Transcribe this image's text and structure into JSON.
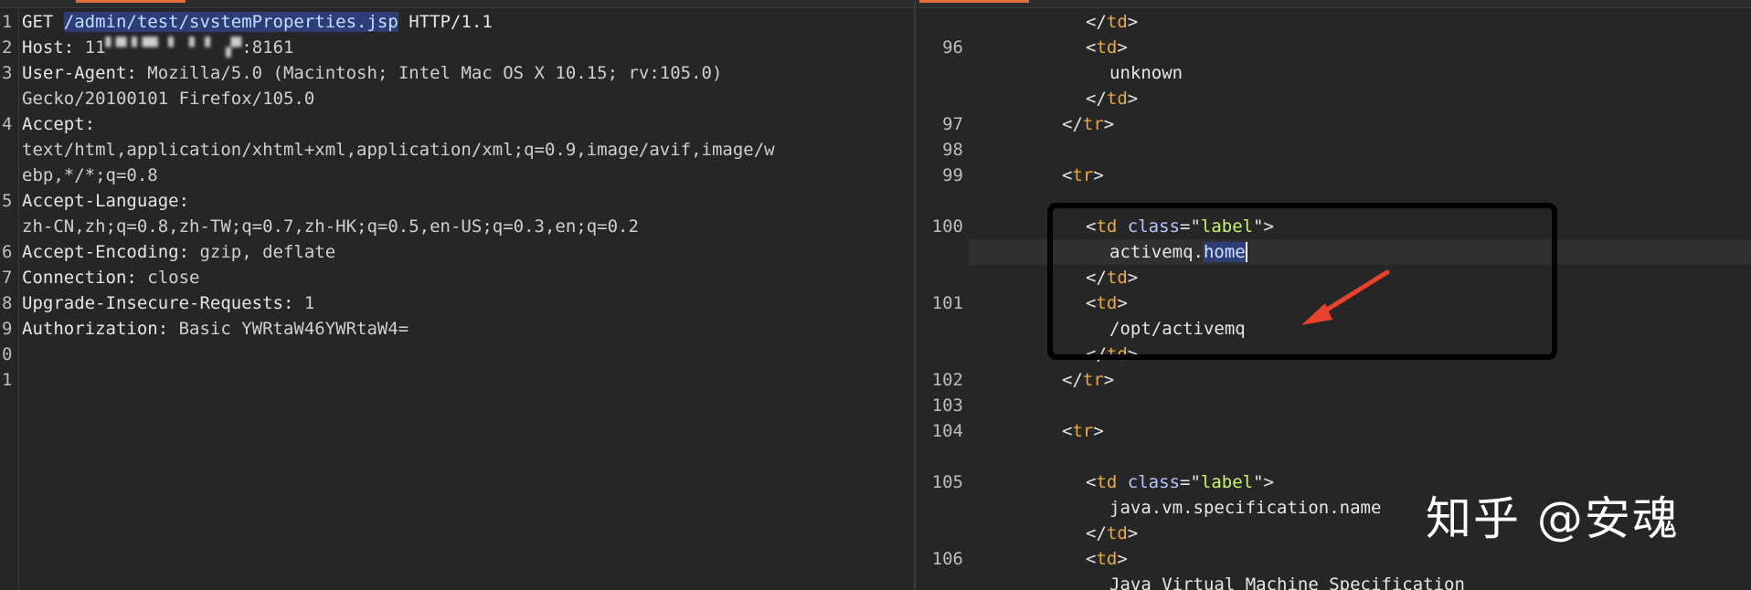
{
  "request": {
    "lines": [
      {
        "n": "1",
        "segs": [
          {
            "t": "GET ",
            "c": "hk"
          },
          {
            "t": "/admin/test/svstemProperties.jsp",
            "c": "path"
          },
          {
            "t": " HTTP/1.1",
            "c": "hk"
          }
        ]
      },
      {
        "n": "2",
        "segs": [
          {
            "t": "Host: ",
            "c": "hk"
          },
          {
            "t": "11",
            "c": "hv"
          },
          {
            "t": "▘▀▝▝▀ ▘ ▘▝ ▗▀",
            "c": "blur"
          },
          {
            "t": ":8161",
            "c": "hv"
          }
        ]
      },
      {
        "n": "3",
        "segs": [
          {
            "t": "User-Agent: ",
            "c": "hk"
          },
          {
            "t": "Mozilla/5.0 (Macintosh; Intel Mac OS X 10.15; rv:105.0)",
            "c": "hv"
          }
        ]
      },
      {
        "n": "",
        "segs": [
          {
            "t": "Gecko/20100101 Firefox/105.0",
            "c": "hv"
          }
        ]
      },
      {
        "n": "4",
        "segs": [
          {
            "t": "Accept:",
            "c": "hk"
          }
        ]
      },
      {
        "n": "",
        "segs": [
          {
            "t": "text/html,application/xhtml+xml,application/xml;q=0.9,image/avif,image/w",
            "c": "hv"
          }
        ]
      },
      {
        "n": "",
        "segs": [
          {
            "t": "ebp,*/*;q=0.8",
            "c": "hv"
          }
        ]
      },
      {
        "n": "5",
        "segs": [
          {
            "t": "Accept-Language:",
            "c": "hk"
          }
        ]
      },
      {
        "n": "",
        "segs": [
          {
            "t": "zh-CN,zh;q=0.8,zh-TW;q=0.7,zh-HK;q=0.5,en-US;q=0.3,en;q=0.2",
            "c": "hv"
          }
        ]
      },
      {
        "n": "6",
        "segs": [
          {
            "t": "Accept-Encoding: ",
            "c": "hk"
          },
          {
            "t": "gzip, deflate",
            "c": "hv"
          }
        ]
      },
      {
        "n": "7",
        "segs": [
          {
            "t": "Connection: ",
            "c": "hk"
          },
          {
            "t": "close",
            "c": "hv"
          }
        ]
      },
      {
        "n": "8",
        "segs": [
          {
            "t": "Upgrade-Insecure-Requests: ",
            "c": "hk"
          },
          {
            "t": "1",
            "c": "hv"
          }
        ]
      },
      {
        "n": "9",
        "segs": [
          {
            "t": "Authorization: ",
            "c": "hk"
          },
          {
            "t": "Basic YWRtaW46YWRtaW4=",
            "c": "hv"
          }
        ]
      },
      {
        "n": "0",
        "segs": []
      },
      {
        "n": "1",
        "segs": []
      }
    ]
  },
  "response": {
    "lines": [
      {
        "n": "",
        "i": 6,
        "segs": [
          {
            "t": "</",
            "c": "p"
          },
          {
            "t": "td",
            "c": "t"
          },
          {
            "t": ">",
            "c": "p"
          }
        ]
      },
      {
        "n": "96",
        "i": 6,
        "segs": [
          {
            "t": "<",
            "c": "p"
          },
          {
            "t": "td",
            "c": "t"
          },
          {
            "t": ">",
            "c": "p"
          }
        ]
      },
      {
        "n": "",
        "i": 8,
        "segs": [
          {
            "t": "unknown",
            "c": "txt"
          }
        ]
      },
      {
        "n": "",
        "i": 6,
        "segs": [
          {
            "t": "</",
            "c": "p"
          },
          {
            "t": "td",
            "c": "t"
          },
          {
            "t": ">",
            "c": "p"
          }
        ]
      },
      {
        "n": "97",
        "i": 4,
        "segs": [
          {
            "t": "</",
            "c": "p"
          },
          {
            "t": "tr",
            "c": "t"
          },
          {
            "t": ">",
            "c": "p"
          }
        ]
      },
      {
        "n": "98",
        "i": 0,
        "segs": []
      },
      {
        "n": "99",
        "i": 4,
        "segs": [
          {
            "t": "<",
            "c": "p"
          },
          {
            "t": "tr",
            "c": "t"
          },
          {
            "t": ">",
            "c": "p"
          }
        ]
      },
      {
        "n": "",
        "i": 0,
        "segs": []
      },
      {
        "n": "100",
        "i": 6,
        "segs": [
          {
            "t": "<",
            "c": "p"
          },
          {
            "t": "td",
            "c": "t"
          },
          {
            "t": " ",
            "c": "p"
          },
          {
            "t": "class",
            "c": "a"
          },
          {
            "t": "=\"",
            "c": "p"
          },
          {
            "t": "label",
            "c": "s"
          },
          {
            "t": "\">",
            "c": "p"
          }
        ]
      },
      {
        "n": "",
        "i": 8,
        "hl": true,
        "segs": [
          {
            "t": "activemq.",
            "c": "txt"
          },
          {
            "t": "home",
            "c": "sel"
          }
        ]
      },
      {
        "n": "",
        "i": 6,
        "segs": [
          {
            "t": "</",
            "c": "p"
          },
          {
            "t": "td",
            "c": "t"
          },
          {
            "t": ">",
            "c": "p"
          }
        ]
      },
      {
        "n": "101",
        "i": 6,
        "segs": [
          {
            "t": "<",
            "c": "p"
          },
          {
            "t": "td",
            "c": "t"
          },
          {
            "t": ">",
            "c": "p"
          }
        ]
      },
      {
        "n": "",
        "i": 8,
        "segs": [
          {
            "t": "/opt/activemq",
            "c": "txt"
          }
        ]
      },
      {
        "n": "",
        "i": 6,
        "segs": [
          {
            "t": "</",
            "c": "p"
          },
          {
            "t": "td",
            "c": "t"
          },
          {
            "t": ">",
            "c": "p"
          }
        ]
      },
      {
        "n": "102",
        "i": 4,
        "segs": [
          {
            "t": "</",
            "c": "p"
          },
          {
            "t": "tr",
            "c": "t"
          },
          {
            "t": ">",
            "c": "p"
          }
        ]
      },
      {
        "n": "103",
        "i": 0,
        "segs": []
      },
      {
        "n": "104",
        "i": 4,
        "segs": [
          {
            "t": "<",
            "c": "p"
          },
          {
            "t": "tr",
            "c": "t"
          },
          {
            "t": ">",
            "c": "p"
          }
        ]
      },
      {
        "n": "",
        "i": 0,
        "segs": []
      },
      {
        "n": "105",
        "i": 6,
        "segs": [
          {
            "t": "<",
            "c": "p"
          },
          {
            "t": "td",
            "c": "t"
          },
          {
            "t": " ",
            "c": "p"
          },
          {
            "t": "class",
            "c": "a"
          },
          {
            "t": "=\"",
            "c": "p"
          },
          {
            "t": "label",
            "c": "s"
          },
          {
            "t": "\">",
            "c": "p"
          }
        ]
      },
      {
        "n": "",
        "i": 8,
        "segs": [
          {
            "t": "java.vm.specification.name",
            "c": "txt"
          }
        ]
      },
      {
        "n": "",
        "i": 6,
        "segs": [
          {
            "t": "</",
            "c": "p"
          },
          {
            "t": "td",
            "c": "t"
          },
          {
            "t": ">",
            "c": "p"
          }
        ]
      },
      {
        "n": "106",
        "i": 6,
        "segs": [
          {
            "t": "<",
            "c": "p"
          },
          {
            "t": "td",
            "c": "t"
          },
          {
            "t": ">",
            "c": "p"
          }
        ]
      },
      {
        "n": "",
        "i": 8,
        "segs": [
          {
            "t": "Java Virtual Machine Specification",
            "c": "txt"
          }
        ]
      }
    ]
  },
  "watermark": "知乎 @安魂",
  "colors": {
    "tag": "#e8a948",
    "attr": "#b8c6ff",
    "string": "#c7f36b",
    "selection": "#2e3c78",
    "arrow": "#e8412c",
    "tab_accent": "#e4703a"
  }
}
